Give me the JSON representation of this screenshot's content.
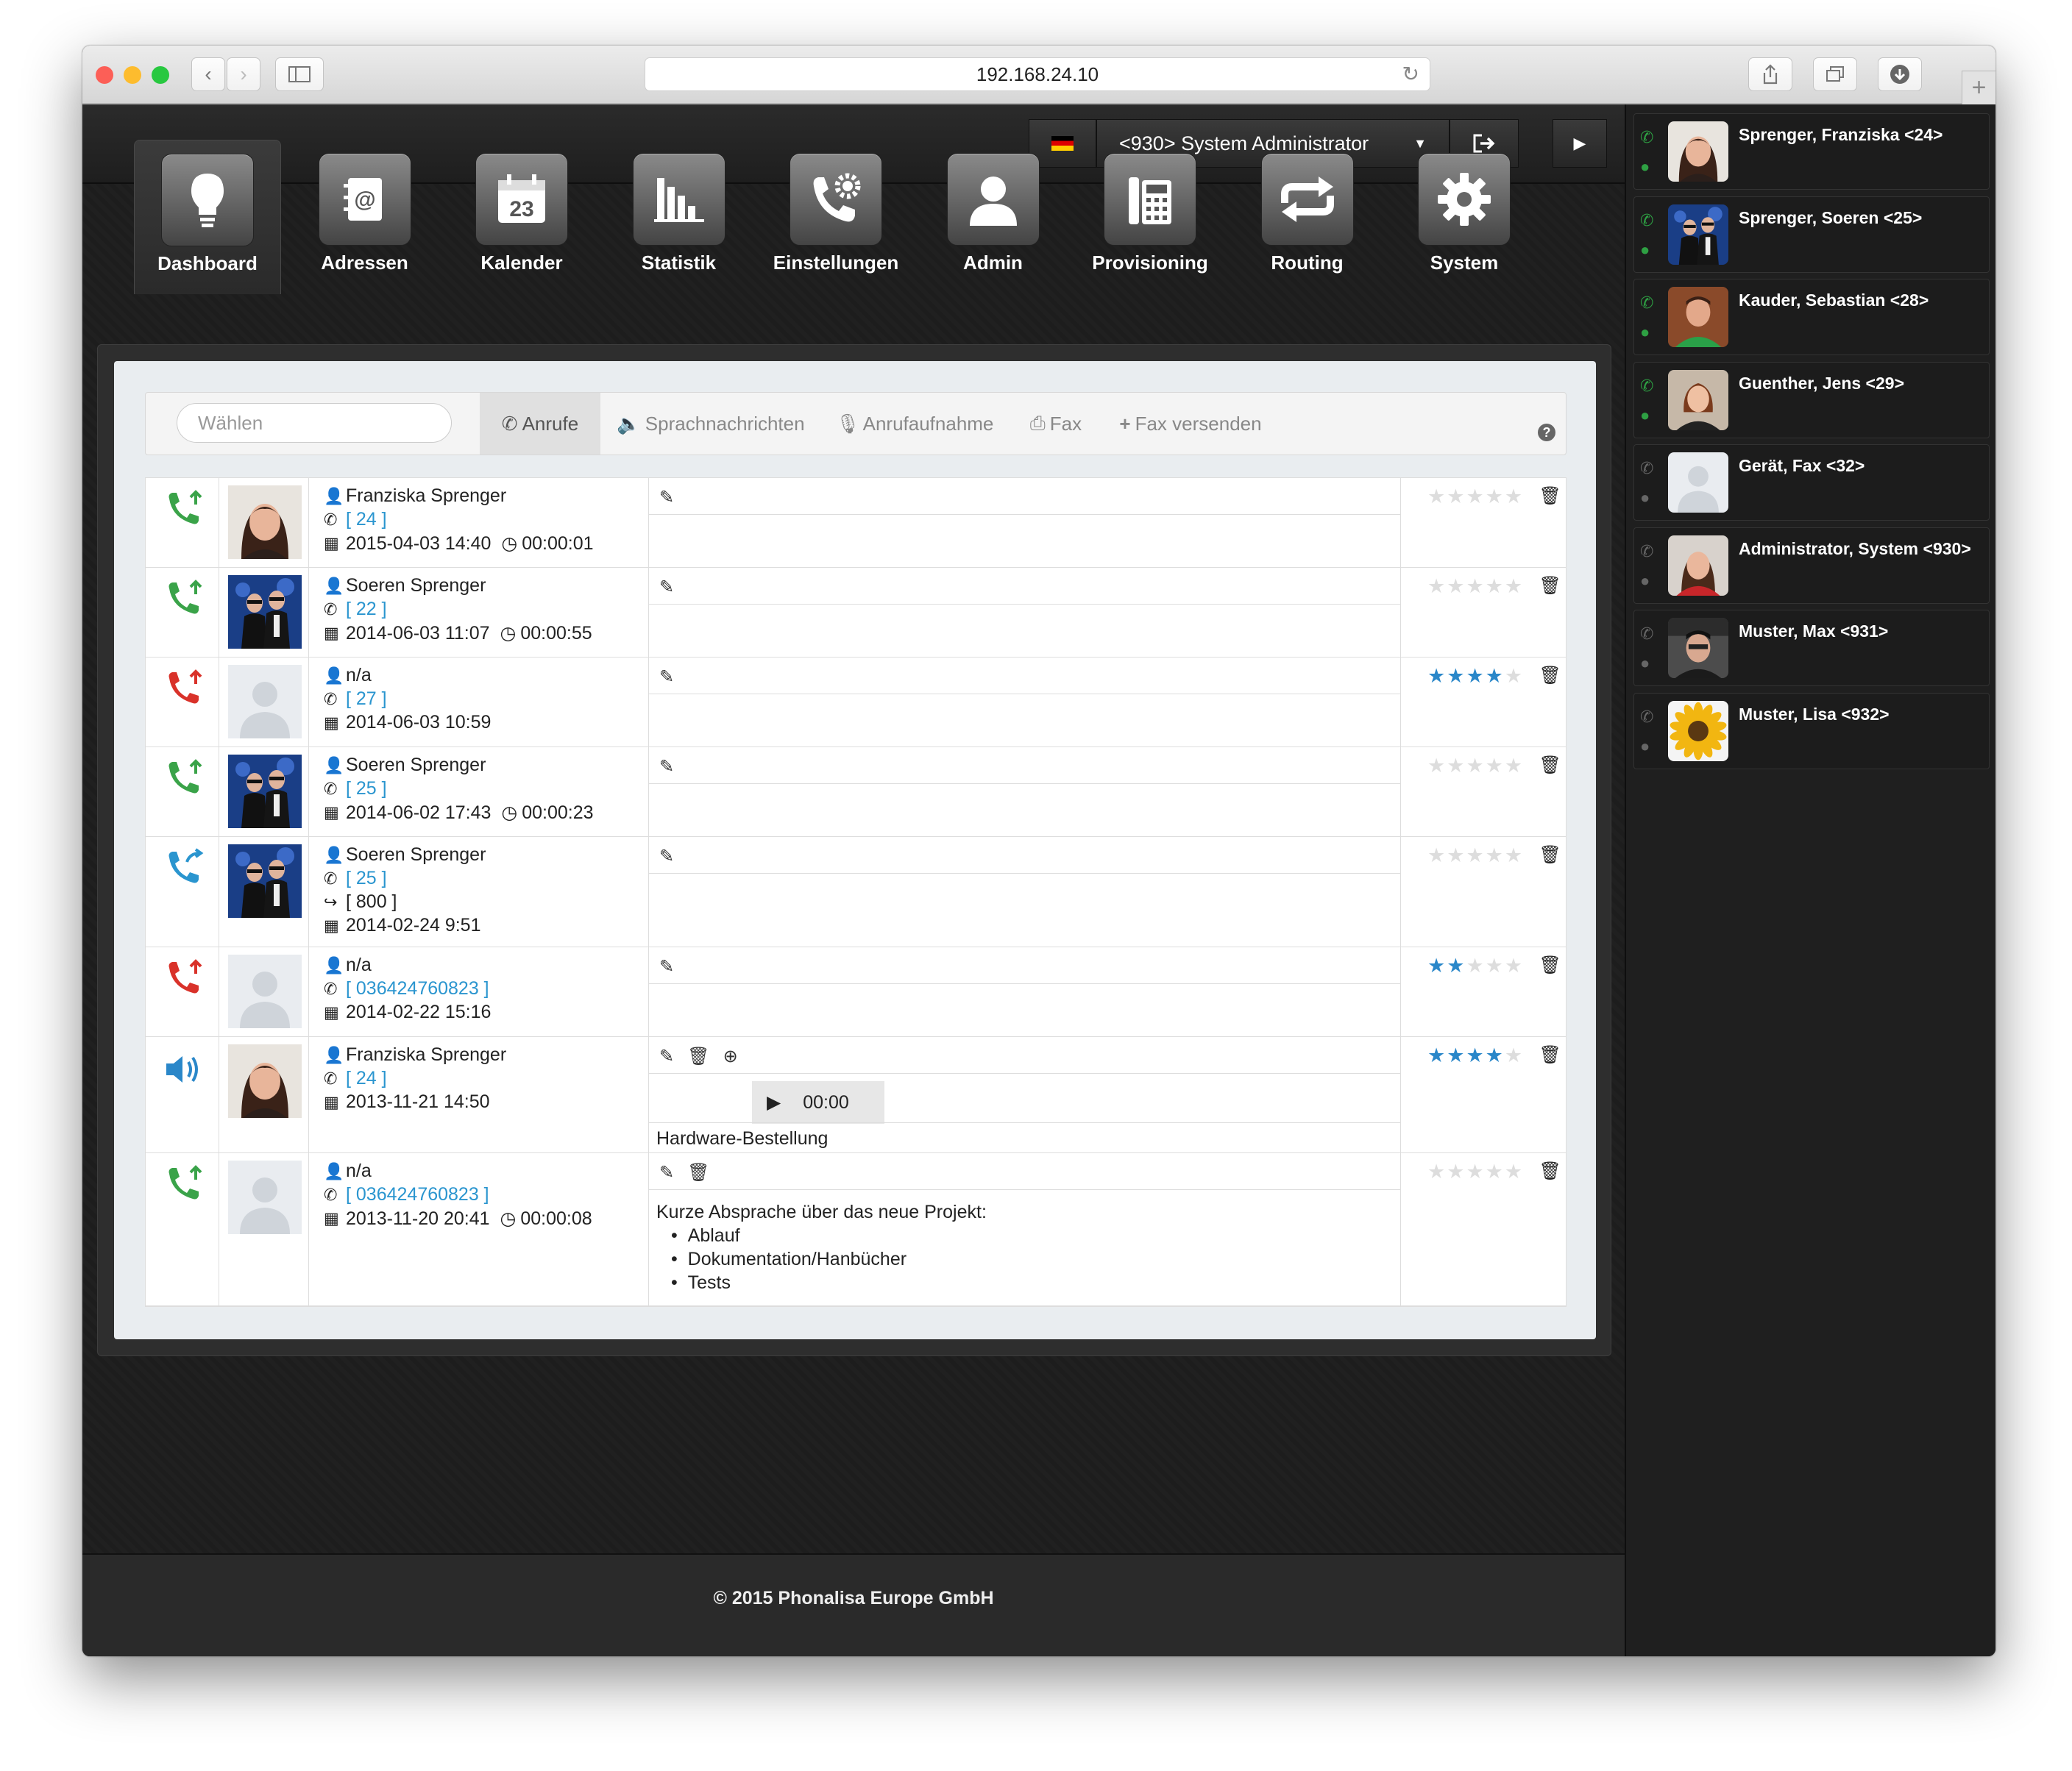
{
  "browser": {
    "url": "192.168.24.10"
  },
  "topbar": {
    "flag": "de-flag",
    "user_label": "<930> System Administrator"
  },
  "nav": [
    {
      "label": "Dashboard",
      "icon": "lightbulb-icon",
      "active": true
    },
    {
      "label": "Adressen",
      "icon": "address-book-icon"
    },
    {
      "label": "Kalender",
      "icon": "calendar-icon",
      "num": "23"
    },
    {
      "label": "Statistik",
      "icon": "bar-chart-icon"
    },
    {
      "label": "Einstellungen",
      "icon": "phone-gear-icon"
    },
    {
      "label": "Admin",
      "icon": "user-icon"
    },
    {
      "label": "Provisioning",
      "icon": "desk-phone-icon"
    },
    {
      "label": "Routing",
      "icon": "repeat-icon"
    },
    {
      "label": "System",
      "icon": "gear-icon"
    }
  ],
  "toolbar": {
    "search_placeholder": "Wählen",
    "tabs": [
      {
        "label": "Anrufe",
        "icon": "phone-icon",
        "active": true
      },
      {
        "label": "Sprachnachrichten",
        "icon": "speaker-icon"
      },
      {
        "label": "Anrufaufnahme",
        "icon": "mic-icon"
      },
      {
        "label": "Fax",
        "icon": "printer-icon"
      },
      {
        "label": "Fax versenden",
        "icon": "plus-icon"
      }
    ],
    "help": "?"
  },
  "calls": [
    {
      "type": "in",
      "name": "Franziska Sprenger",
      "number": "[ 24 ]",
      "datetime": "2015-04-03 14:40",
      "duration": "00:00:01",
      "photo": "woman",
      "stars": 0
    },
    {
      "type": "in",
      "name": "Soeren Sprenger",
      "number": "[ 22 ]",
      "datetime": "2014-06-03 11:07",
      "duration": "00:00:55",
      "photo": "group",
      "stars": 0
    },
    {
      "type": "missed",
      "name": "n/a",
      "number": "[ 27 ]",
      "datetime": "2014-06-03 10:59",
      "duration": "",
      "photo": "blank",
      "stars": 4
    },
    {
      "type": "in",
      "name": "Soeren Sprenger",
      "number": "[ 25 ]",
      "datetime": "2014-06-02 17:43",
      "duration": "00:00:23",
      "photo": "group",
      "stars": 0
    },
    {
      "type": "forward",
      "name": "Soeren Sprenger",
      "number": "[ 25 ]",
      "forward": "[ 800 ]",
      "datetime": "2014-02-24 9:51",
      "duration": "",
      "photo": "group",
      "stars": 0
    },
    {
      "type": "missed",
      "name": "n/a",
      "number": "[ 036424760823 ]",
      "datetime": "2014-02-22 15:16",
      "duration": "",
      "photo": "blank",
      "stars": 2
    },
    {
      "type": "voicemail",
      "name": "Franziska Sprenger",
      "number": "[ 24 ]",
      "datetime": "2013-11-21 14:50",
      "duration": "",
      "photo": "woman",
      "stars": 4,
      "audio_time": "00:00",
      "note": "Hardware-Bestellung"
    },
    {
      "type": "in",
      "name": "n/a",
      "number": "[ 036424760823 ]",
      "datetime": "2013-11-20 20:41",
      "duration": "00:00:08",
      "photo": "blank",
      "stars": 0,
      "note_title": "Kurze Absprache über das neue Projekt:",
      "note_items": [
        "Ablauf",
        "Dokumentation/Hanbücher",
        "Tests"
      ]
    }
  ],
  "contacts": [
    {
      "name": "Sprenger, Franziska <24>",
      "photo": "woman",
      "online": true
    },
    {
      "name": "Sprenger, Soeren <25>",
      "photo": "group",
      "online": true
    },
    {
      "name": "Kauder, Sebastian <28>",
      "photo": "man-green",
      "online": true
    },
    {
      "name": "Guenther, Jens <29>",
      "photo": "man-red",
      "online": true
    },
    {
      "name": "Gerät, Fax <32>",
      "photo": "blank",
      "online": false
    },
    {
      "name": "Administrator, System <930>",
      "photo": "woman-red",
      "online": false
    },
    {
      "name": "Muster, Max <931>",
      "photo": "man-dark",
      "online": false
    },
    {
      "name": "Muster, Lisa <932>",
      "photo": "sunflower",
      "online": false
    }
  ],
  "footer": "© 2015 Phonalisa Europe GmbH",
  "colors": {
    "incoming": "#3aa349",
    "missed": "#d9322a",
    "forward": "#2a95cf",
    "star": "#2a87c9",
    "link": "#2a95cf"
  }
}
